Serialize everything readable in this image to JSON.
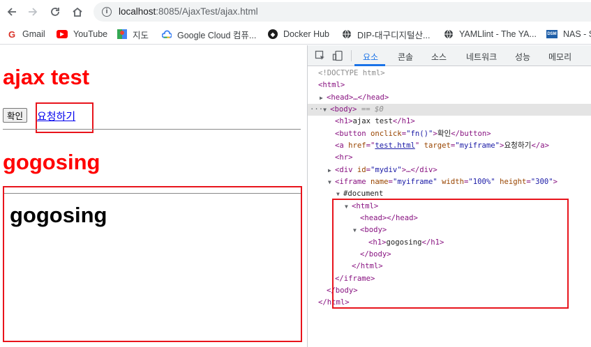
{
  "browser": {
    "url_host": "localhost",
    "url_rest": ":8085/AjaxTest/ajax.html"
  },
  "bookmarks": [
    {
      "label": "Gmail",
      "icon": "gmail-icon"
    },
    {
      "label": "YouTube",
      "icon": "youtube-icon"
    },
    {
      "label": "지도",
      "icon": "maps-icon"
    },
    {
      "label": "Google Cloud 컴퓨...",
      "icon": "google-cloud-icon"
    },
    {
      "label": "Docker Hub",
      "icon": "docker-icon"
    },
    {
      "label": "DIP-대구디지털산...",
      "icon": "globe-icon"
    },
    {
      "label": "YAMLlint - The YA...",
      "icon": "globe-icon"
    },
    {
      "label": "NAS - S",
      "icon": "dsm-icon"
    }
  ],
  "page": {
    "title": "ajax test",
    "button_label": "확인",
    "link_text": "요청하기",
    "div_heading": "gogosing",
    "iframe_heading": "gogosing"
  },
  "devtools": {
    "tabs": [
      "요소",
      "콘솔",
      "소스",
      "네트워크",
      "성능",
      "메모리"
    ],
    "active_tab": "요소",
    "dom": {
      "doctype": "<!DOCTYPE html>",
      "html_open": "<html>",
      "head_collapsed": "<head>…</head>",
      "body_open": "<body>",
      "body_eq": "== $0",
      "h1_text": "ajax test",
      "button_attr": "onclick",
      "button_val": "\"fn()\"",
      "button_text": "확인",
      "a_href_attr": "href",
      "a_href_val": "test.html",
      "a_target_attr": "target",
      "a_target_val": "\"myiframe\"",
      "a_text": "요청하기",
      "hr": "<hr>",
      "div_id_attr": "id",
      "div_id_val": "\"mydiv\"",
      "div_rest": ">…</div>",
      "iframe_name_attr": "name",
      "iframe_name_val": "\"myiframe\"",
      "iframe_width_attr": "width",
      "iframe_width_val": "\"100%\"",
      "iframe_height_attr": "height",
      "iframe_height_val": "\"300\"",
      "document": "#document",
      "inner_html_open": "<html>",
      "inner_head": "<head></head>",
      "inner_body_open": "<body>",
      "inner_h1_text": "gogosing",
      "inner_body_close": "</body>",
      "inner_html_close": "</html>",
      "iframe_close": "</iframe>",
      "body_close": "</body>",
      "html_close": "</html>"
    }
  }
}
